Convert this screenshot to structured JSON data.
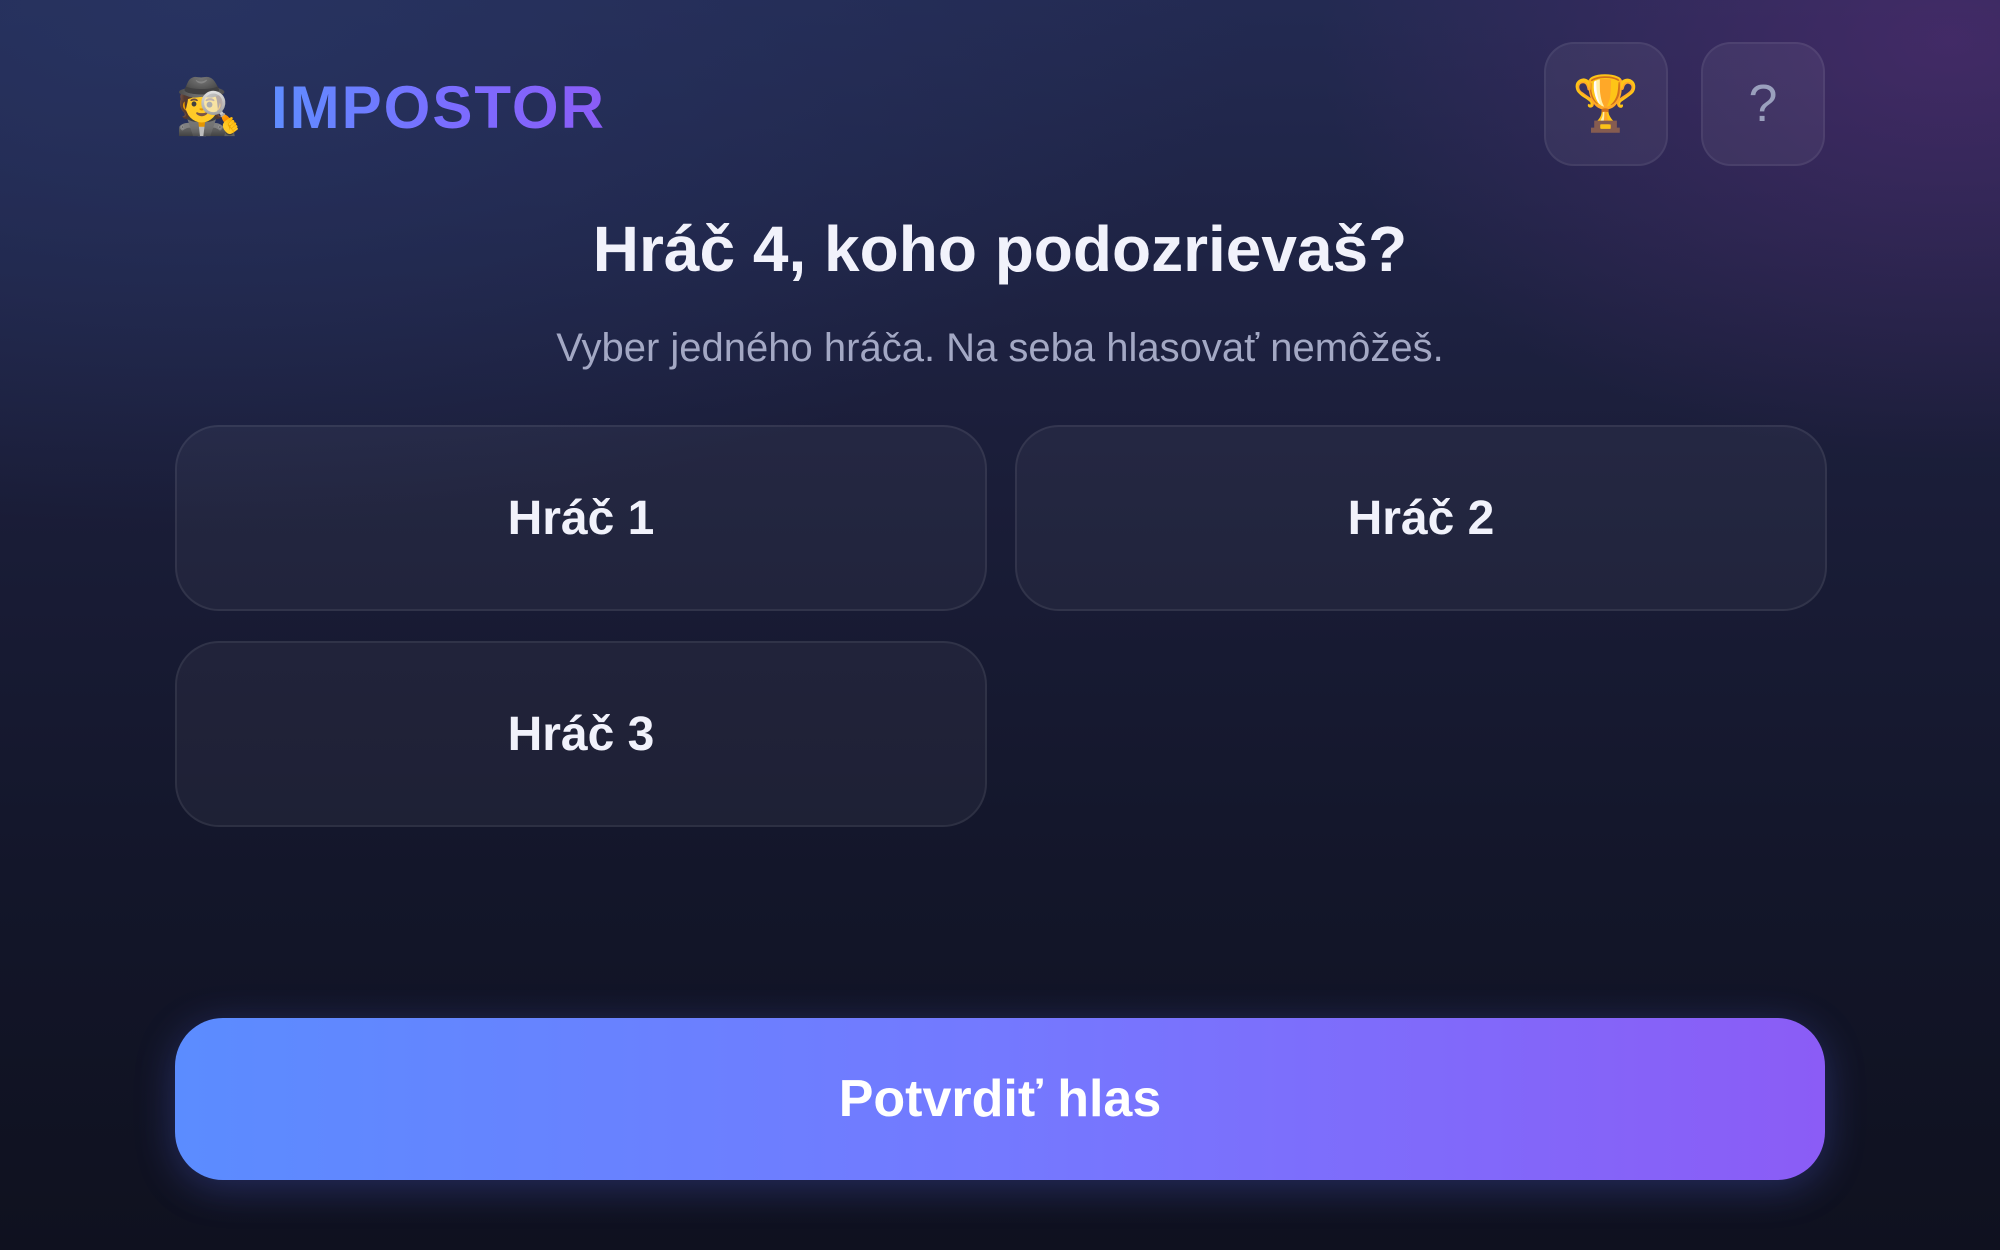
{
  "header": {
    "brand_icon": "🕵",
    "brand_title": "IMPOSTOR",
    "leaderboard_icon": "🏆",
    "help_icon": "?"
  },
  "vote": {
    "question": "Hráč 4, koho podozrievaš?",
    "subtitle": "Vyber jedného hráča. Na seba hlasovať nemôžeš.",
    "players": [
      {
        "label": "Hráč 1"
      },
      {
        "label": "Hráč 2"
      },
      {
        "label": "Hráč 3"
      }
    ],
    "confirm_label": "Potvrdiť hlas"
  },
  "colors": {
    "accent_start": "#5b8cff",
    "accent_end": "#8b5cf6",
    "background": "#13162a"
  }
}
